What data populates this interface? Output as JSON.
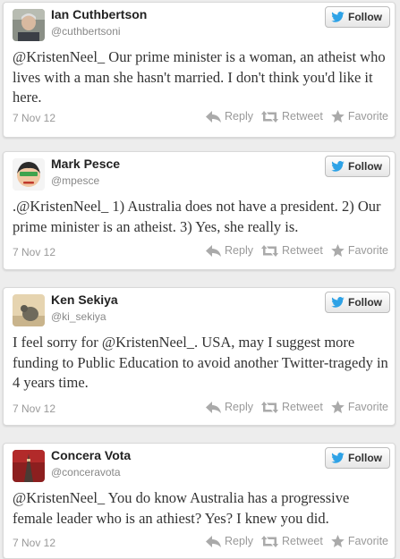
{
  "colors": {
    "twitter_blue": "#2ea2e6",
    "action_gray": "#aaaaaa"
  },
  "follow_label": "Follow",
  "actions": {
    "reply": "Reply",
    "retweet": "Retweet",
    "favorite": "Favorite"
  },
  "tweets": [
    {
      "name": "Ian Cuthbertson",
      "handle": "@cuthbertsoni",
      "text": "@KristenNeel_ Our prime minister is a woman, an atheist who lives with a man she hasn't married. I don't think you'd like it here.",
      "date": "7 Nov 12"
    },
    {
      "name": "Mark Pesce",
      "handle": "@mpesce",
      "text": ".@KristenNeel_ 1) Australia does not have a president. 2) Our prime minister is an atheist. 3) Yes, she really is.",
      "date": "7 Nov 12"
    },
    {
      "name": "Ken Sekiya",
      "handle": "@ki_sekiya",
      "text": "I feel sorry for @KristenNeel_. USA, may I suggest more funding to Public Education to avoid another Twitter-tragedy in 4 years time.",
      "date": "7 Nov 12"
    },
    {
      "name": "Concera Vota",
      "handle": "@conceravota",
      "text": "@KristenNeel_ You do know Australia has a progressive female leader who is an athiest? Yes? I knew you did.",
      "date": "7 Nov 12"
    }
  ]
}
